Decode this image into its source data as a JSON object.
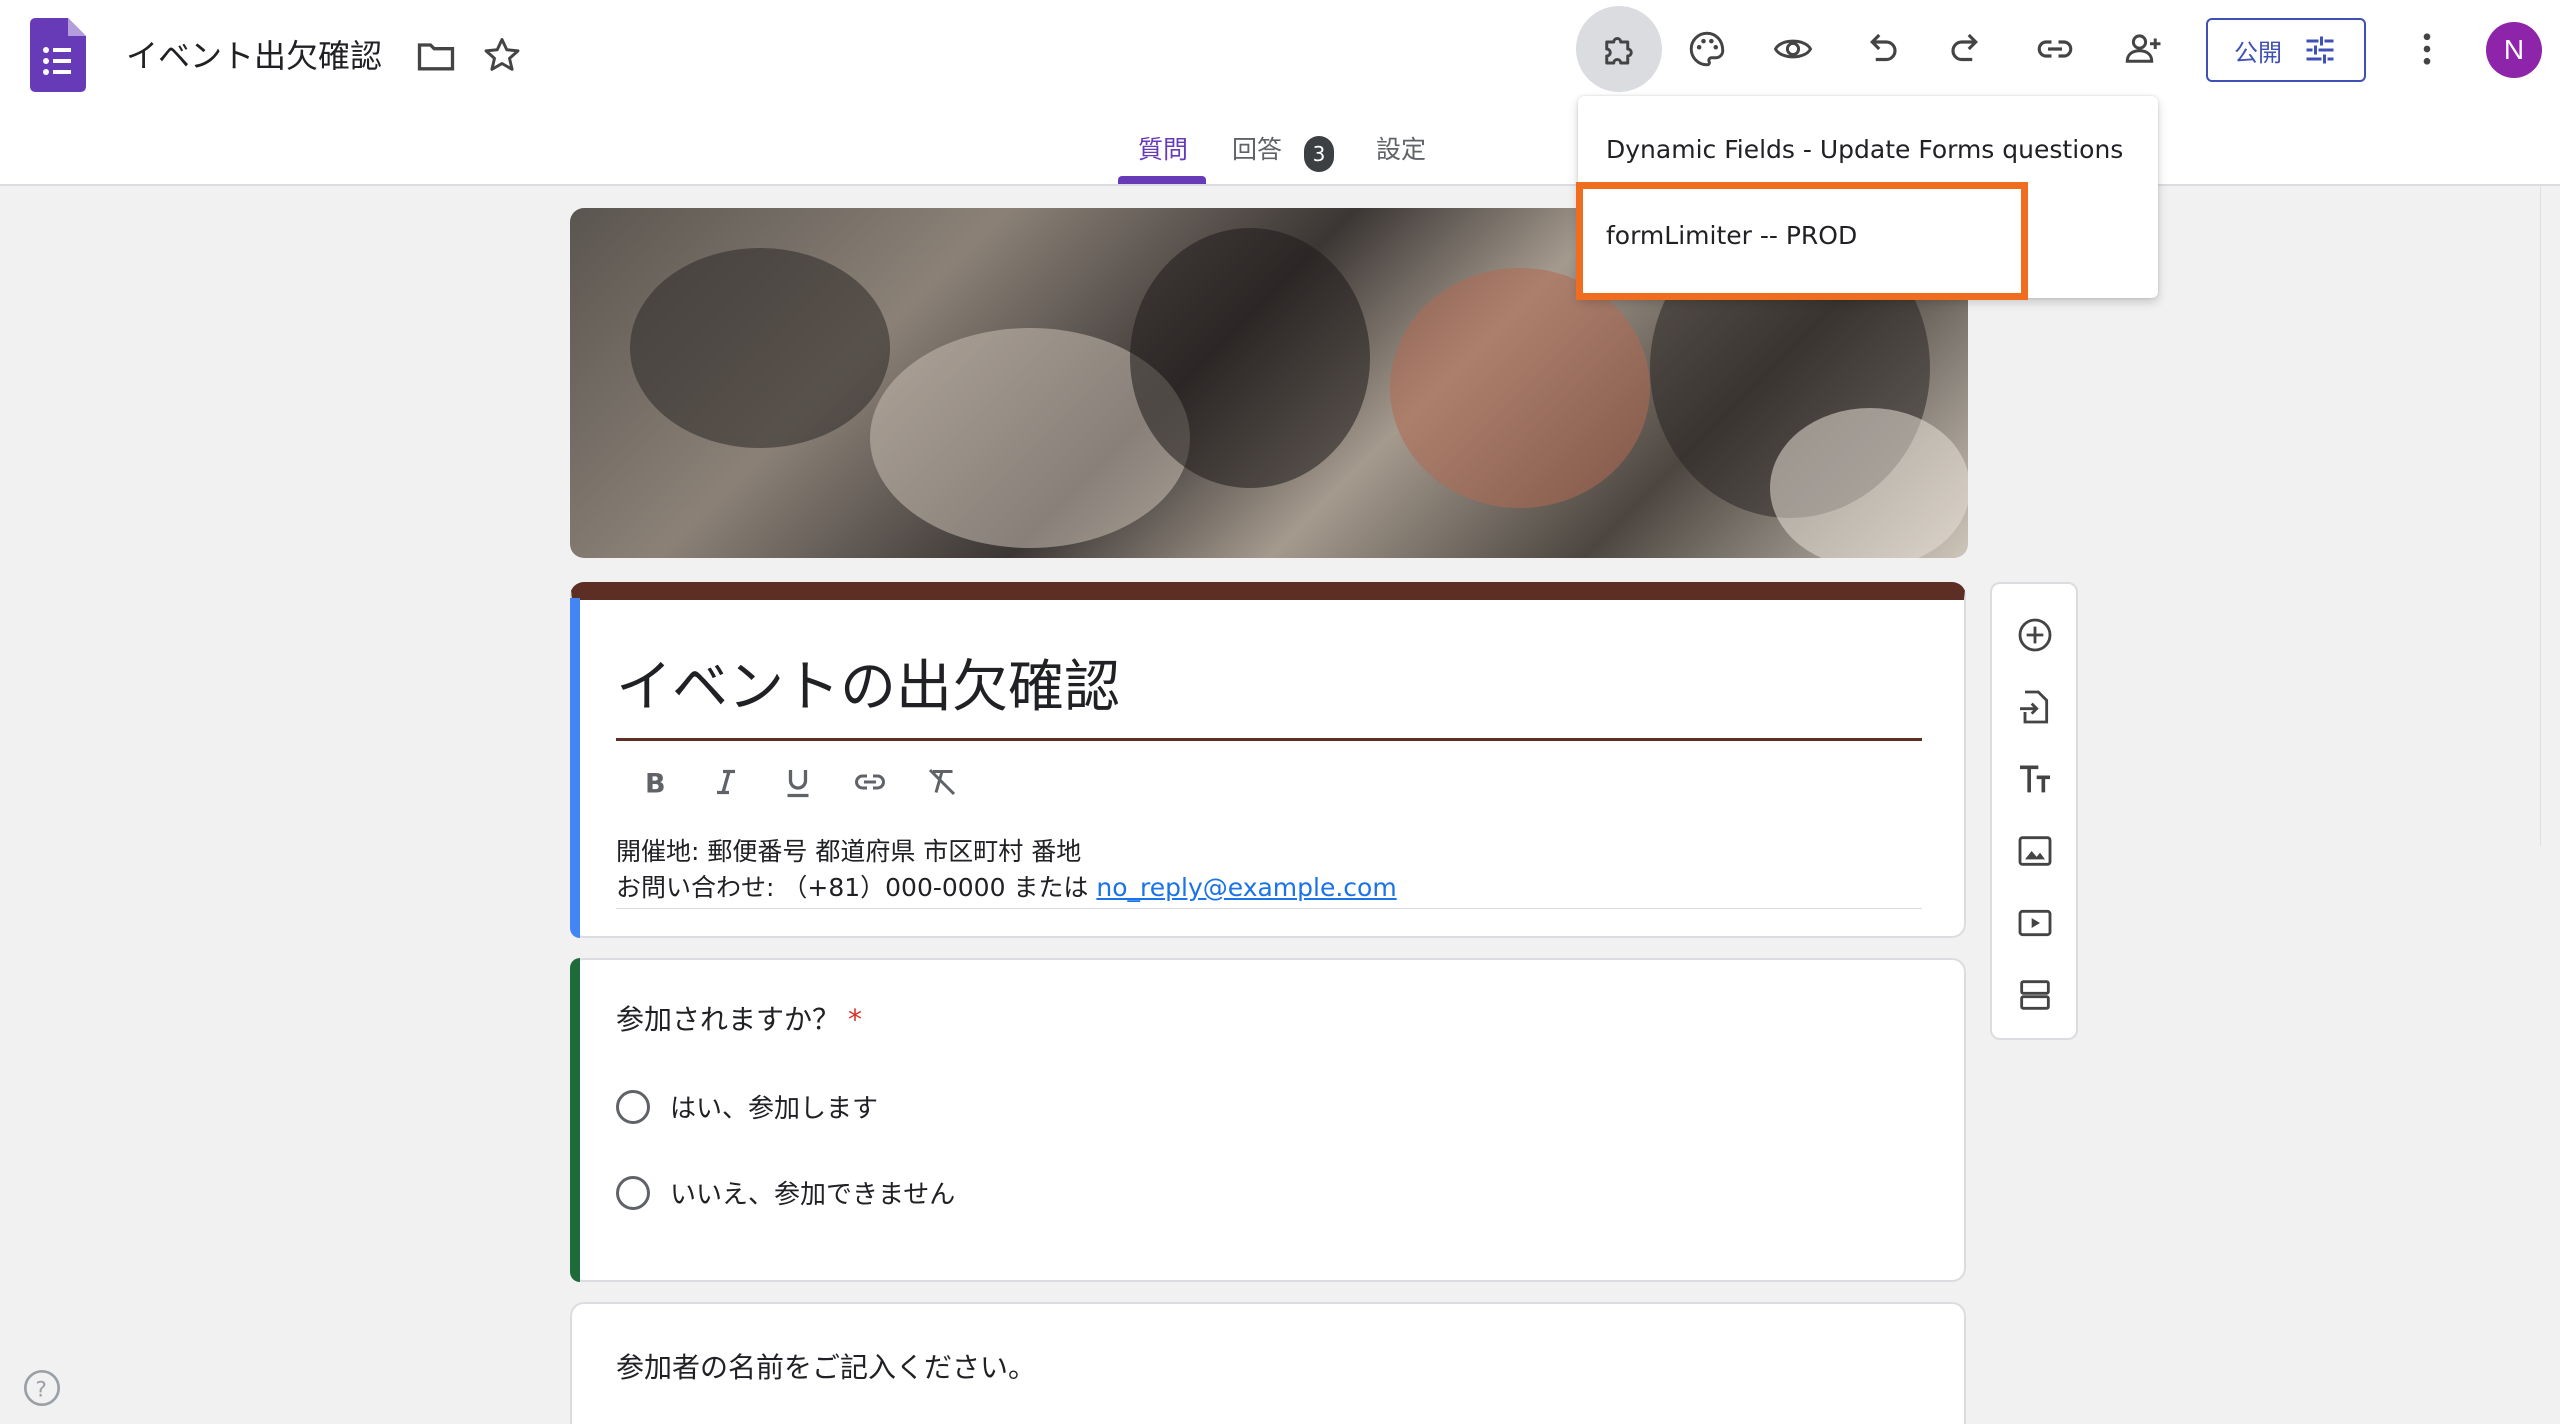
{
  "header": {
    "doc_title": "イベント出欠確認",
    "publish_label": "公開",
    "avatar_initial": "N"
  },
  "tabs": [
    {
      "label": "質問",
      "active": true
    },
    {
      "label": "回答",
      "badge": "3"
    },
    {
      "label": "設定"
    }
  ],
  "addon_menu": {
    "items": [
      "Dynamic Fields - Update Forms questions",
      "formLimiter -- PROD"
    ],
    "highlighted_index": 1
  },
  "form": {
    "title": "イベントの出欠確認",
    "description_line1": "開催地: 郵便番号 都道府県 市区町村 番地",
    "description_line2_prefix": "お問い合わせ: （+81）000-0000 または ",
    "description_email": "no_reply@example.com"
  },
  "questions": [
    {
      "title": "参加されますか？",
      "required_mark": "*",
      "options": [
        "はい、参加します",
        "いいえ、参加できません"
      ]
    },
    {
      "title": "参加者の名前をご記入ください。"
    }
  ],
  "icons": {
    "toolbar": [
      "addons-icon",
      "palette-icon",
      "preview-icon",
      "undo-icon",
      "redo-icon",
      "link-icon",
      "add-collaborator-icon",
      "more-vert-icon"
    ],
    "side": [
      "add-question-icon",
      "import-questions-icon",
      "title-text-icon",
      "image-icon",
      "video-icon",
      "section-icon"
    ],
    "format": [
      "bold-icon",
      "italic-icon",
      "underline-icon",
      "link-icon",
      "clear-format-icon"
    ]
  },
  "colors": {
    "accent": "#673ab7",
    "theme": "#5d2e24",
    "highlight": "#f06c1f",
    "avatar": "#8e24aa"
  }
}
